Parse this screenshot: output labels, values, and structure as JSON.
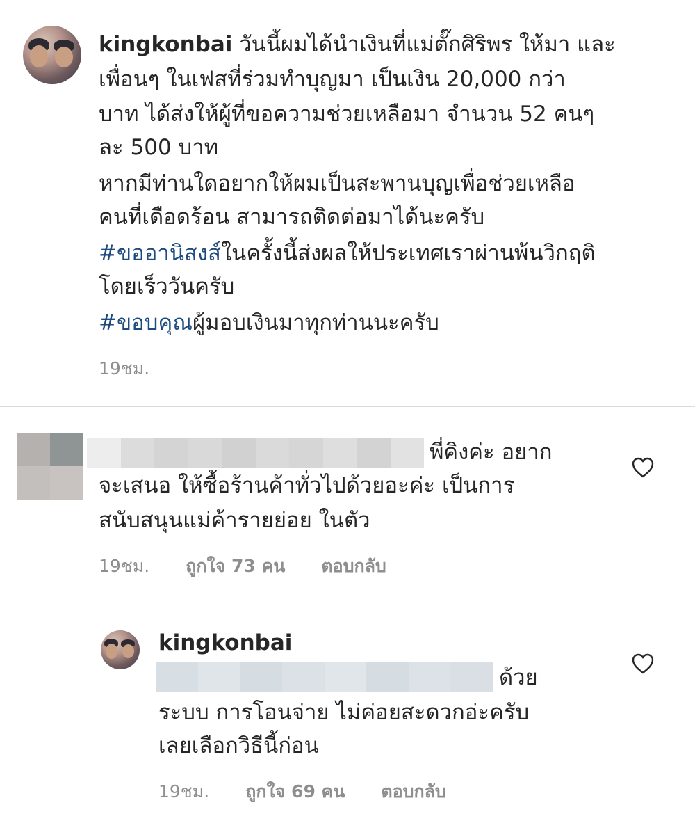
{
  "post": {
    "username": "kingkonbai",
    "caption_line1_rest": " วันนี้ผมได้นำเงินที่แม่ตั๊กศิริพร ให้มา และ",
    "caption_line2": "เพื่อนๆ ในเฟสที่ร่วมทำบุญมา เป็นเงิน 20,000 กว่า",
    "caption_line3": "บาท ได้ส่งให้ผู้ที่ขอความช่วยเหลือมา จำนวน 52 คนๆ",
    "caption_line4": "ละ 500 บาท",
    "caption_line5": "หากมีท่านใดอยากให้ผมเป็นสะพานบุญเพื่อช่วยเหลือ",
    "caption_line6": "คนที่เดือดร้อน สามารถติดต่อมาได้นะครับ",
    "hashtag1": "#ขออานิสงส์",
    "hashtag1_rest": "ในครั้งนี้ส่งผลให้ประเทศเราผ่านพ้นวิกฤติ",
    "caption_line8": "โดยเร็ววันครับ",
    "hashtag2": "#ขอบคุณ",
    "hashtag2_rest": "ผู้มอบเงินมาทุกท่านนะครับ",
    "time": "19ชม."
  },
  "comment": {
    "line1_rest": "พี่คิงค่ะ อยาก",
    "line2": "จะเสนอ ให้ซื้อร้านค้าทั่วไปด้วยอะค่ะ เป็นการ",
    "line3": "สนับสนุนแม่ค้ารายย่อย ในตัว",
    "time": "19ชม.",
    "likes": "ถูกใจ 73 คน",
    "reply": "ตอบกลับ"
  },
  "reply": {
    "username": "kingkonbai",
    "line1_rest": "ด้วย",
    "line2": "ระบบ การโอนจ่าย ไม่ค่อยสะดวกอ่ะครับ",
    "line3": "เลยเลือกวิธีนี้ก่อน",
    "time": "19ชม.",
    "likes": "ถูกใจ 69 คน",
    "reply": "ตอบกลับ"
  },
  "icons": {
    "comment_like": "heart-outline-icon",
    "reply_like": "heart-outline-icon"
  },
  "colors": {
    "text": "#262626",
    "hashtag": "#1e4b7f",
    "meta": "#8e8e8e",
    "divider": "#dbdbdb"
  }
}
